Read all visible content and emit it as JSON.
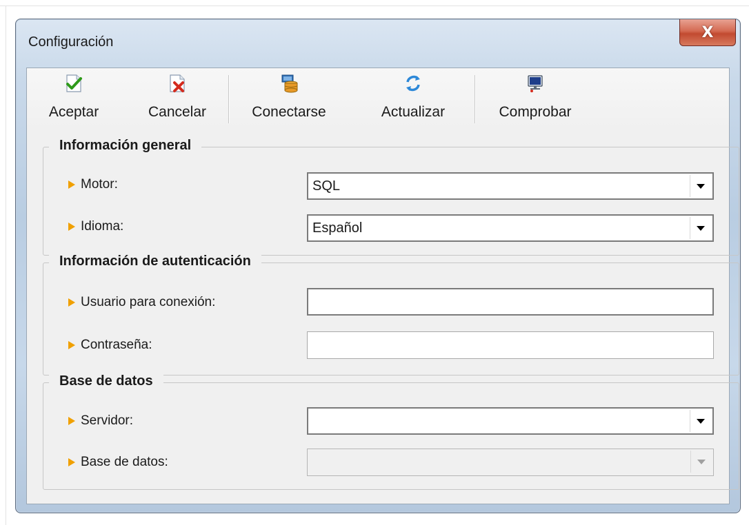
{
  "window": {
    "title": "Configuración",
    "close_label": "X"
  },
  "toolbar": {
    "accept_label": "Aceptar",
    "cancel_label": "Cancelar",
    "connect_label": "Conectarse",
    "refresh_label": "Actualizar",
    "check_label": "Comprobar"
  },
  "general": {
    "legend": "Información general",
    "motor_label": "Motor:",
    "motor_value": "SQL",
    "idioma_label": "Idioma:",
    "idioma_value": "Español"
  },
  "auth": {
    "legend": "Información de autenticación",
    "user_label": "Usuario para conexión:",
    "user_value": "",
    "password_label": "Contraseña:",
    "password_value": ""
  },
  "database": {
    "legend": "Base de datos",
    "server_label": "Servidor:",
    "server_value": "",
    "db_label": "Base de datos:",
    "db_value": ""
  },
  "icons": {
    "accept": "check-icon",
    "cancel": "cancel-icon",
    "connect": "database-icon",
    "refresh": "refresh-icon",
    "check": "monitor-icon"
  },
  "colors": {
    "arrow": "#f0a000",
    "close_button": "#c9553a"
  }
}
